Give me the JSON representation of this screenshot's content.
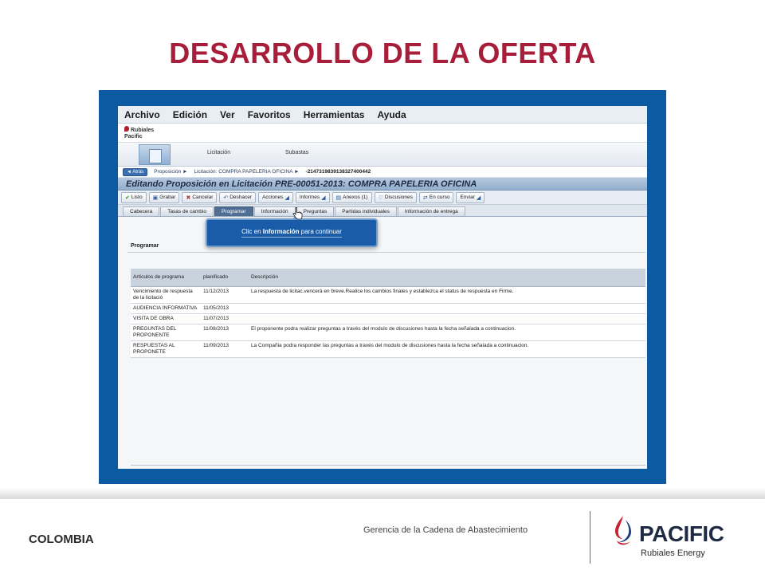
{
  "slide": {
    "title": "DESARROLLO DE LA OFERTA"
  },
  "app": {
    "menu": [
      "Archivo",
      "Edición",
      "Ver",
      "Favoritos",
      "Herramientas",
      "Ayuda"
    ],
    "mini_logo_line1": "Pacific",
    "mini_logo_line2": "Rubiales",
    "nav_tabs": [
      "Licitación",
      "Subastas"
    ],
    "back_label": "Atrás",
    "breadcrumb": {
      "item1": "Proposición ►",
      "item2": "Licitación: COMPRA PAPELERIA OFICINA ►",
      "id": "-2147319839138327400442"
    },
    "doc_title": "Editando Proposición en Licitación PRE-00051-2013: COMPRA PAPELERIA OFICINA",
    "toolbar": {
      "listo": "Listo",
      "grabar": "Grabar",
      "cancelar": "Cancelar",
      "deshacer": "Deshacer",
      "acciones": "Acciones",
      "informes": "Informes",
      "anexos": "Anexos (1)",
      "discusiones": "Discusiones",
      "en_curso": "En curso",
      "enviar": "Enviar"
    },
    "tabs": [
      "Cabecera",
      "Tasas de cambio",
      "Programar",
      "Información",
      "Preguntas",
      "Partidas individuales",
      "Información de entrega"
    ],
    "section_label": "Programar",
    "grid": {
      "headers": [
        "Artículos de programa",
        "planificado",
        "Descripción"
      ],
      "rows": [
        {
          "item": "Vencimiento de respuesta de la licitació",
          "date": "11/12/2013",
          "desc": "La respuesta de licitac.vencerá en breve.Realice los cambios finales y establezca el status de respuesta en Firme."
        },
        {
          "item": "AUDIENCIA INFORMATIVA",
          "date": "11/05/2013",
          "desc": ""
        },
        {
          "item": "VISITA DE OBRA",
          "date": "11/07/2013",
          "desc": ""
        },
        {
          "item": "PREGUNTAS DEL PROPONENTE",
          "date": "11/08/2013",
          "desc": "El proponente podra realizar preguntas a través del modulo de discusiones hasta la fecha señalada a continuacion."
        },
        {
          "item": "RESPUESTAS AL PROPONETE",
          "date": "11/09/2013",
          "desc": "La Compañia podra responder las preguntas a través del modulo de discusiones hasta la fecha señalada a continuacion."
        }
      ]
    },
    "callout": {
      "pre": "Clic en ",
      "bold": "Información",
      "post": " para continuar"
    }
  },
  "footer": {
    "country": "COLOMBIA",
    "department": "Gerencia de la Cadena de Abastecimiento",
    "brand_name": "PACIFIC",
    "brand_sub": "Rubiales Energy"
  },
  "colors": {
    "title": "#a81d3a",
    "frame": "#0b5aa2",
    "callout": "#1b5ca8",
    "active_tab": "#4f6e94"
  },
  "icons": {
    "cursor": "hand-pointer-icon",
    "brand_mark": "pacific-drop-logo"
  }
}
